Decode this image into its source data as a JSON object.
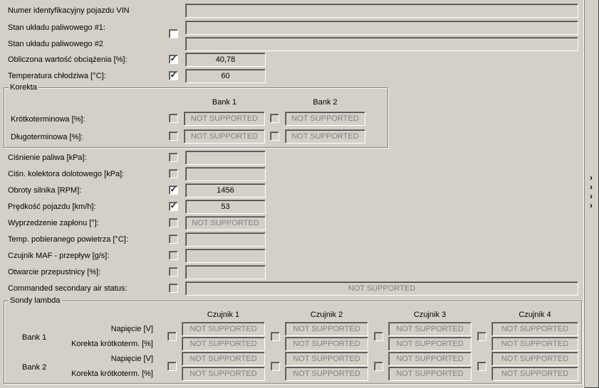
{
  "top_rows": [
    {
      "label": "Numer identyfikacyjny pojazdu VIN",
      "value": ""
    },
    {
      "label": "Stan układu paliwowego #1:",
      "value": ""
    },
    {
      "label": "Stan układu paliwowego #2",
      "value": ""
    },
    {
      "label": "Obliczona wartość obciążenia [%]:",
      "value": "40,78",
      "checked": true
    },
    {
      "label": "Temperatura chłodziwa [°C]:",
      "value": "60",
      "checked": true
    }
  ],
  "korekta": {
    "title": "Korekta",
    "bank1": "Bank 1",
    "bank2": "Bank 2",
    "rows": [
      {
        "label": "Krótkoterminowa [%]:",
        "b1": "NOT SUPPORTED",
        "b2": "NOT SUPPORTED"
      },
      {
        "label": "Długoterminowa [%]:",
        "b1": "NOT SUPPORTED",
        "b2": "NOT SUPPORTED"
      }
    ]
  },
  "mid_rows": [
    {
      "label": "Ciśnienie paliwa [kPa]:",
      "value": "",
      "checked": false
    },
    {
      "label": "Ciśn. kolektora dolotowego [kPa]:",
      "value": "",
      "checked": false
    },
    {
      "label": "Obroty silnika [RPM]:",
      "value": "1456",
      "checked": true
    },
    {
      "label": "Prędkość pojazdu [km/h]:",
      "value": "53",
      "checked": true
    },
    {
      "label": "Wyprzedzenie zapłonu [°]:",
      "value": "NOT SUPPORTED",
      "checked": false,
      "disabled": true
    },
    {
      "label": "Temp. pobieranego powietrza [°C]:",
      "value": "",
      "checked": false
    },
    {
      "label": "Czujnik MAF - przepływ [g/s]:",
      "value": "",
      "checked": false
    },
    {
      "label": "Otwarcie przepustnicy [%]:",
      "value": "",
      "checked": false
    }
  ],
  "secondary_air": {
    "label": "Commanded secondary air status:",
    "value": "NOT SUPPORTED"
  },
  "lambda": {
    "title": "Sondy lambda",
    "sensors": [
      "Czujnik 1",
      "Czujnik 2",
      "Czujnik 3",
      "Czujnik 4"
    ],
    "banks": [
      {
        "label": "Bank 1",
        "rows": [
          "Napięcie [V]",
          "Korekta krótkoterm. [%]"
        ]
      },
      {
        "label": "Bank 2",
        "rows": [
          "Napięcie [V]",
          "Korekta krótkoterm. [%]"
        ]
      }
    ],
    "value": "NOT SUPPORTED"
  },
  "side_panel": {
    "chevron": "›",
    "icon": "chevron-right-icon"
  }
}
